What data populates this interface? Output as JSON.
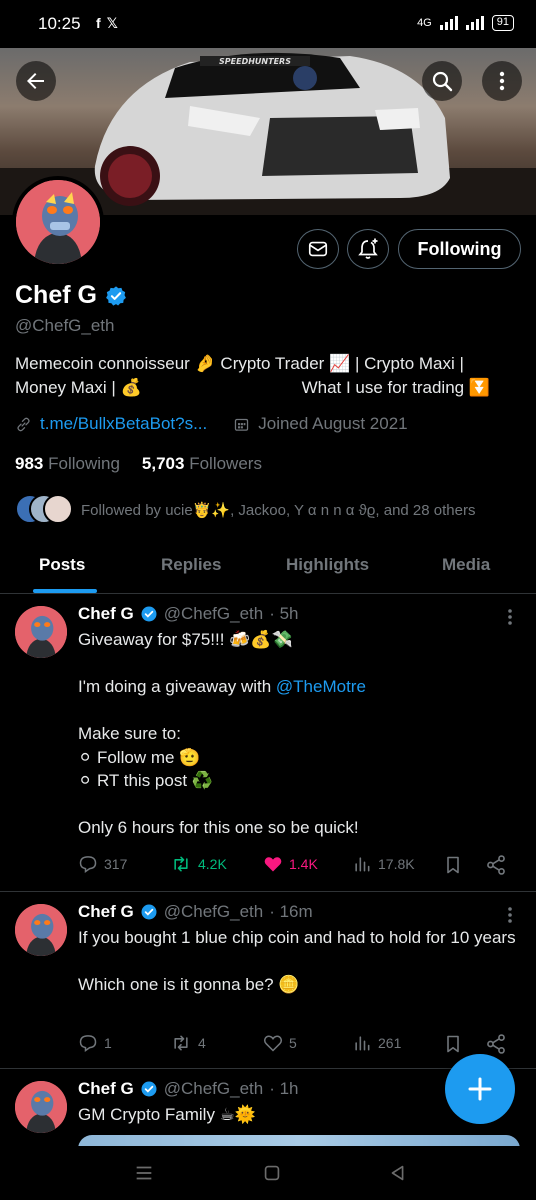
{
  "status_bar": {
    "time": "10:25",
    "left_icons": [
      "facebook-icon",
      "x-icon"
    ],
    "network": "4G",
    "battery": "91"
  },
  "header": {
    "back_icon": "arrow-left-icon",
    "search_icon": "search-icon",
    "more_icon": "more-vertical-icon",
    "banner_text": "SPEEDHUNTERS"
  },
  "profile": {
    "name": "Chef G",
    "verified": true,
    "handle": "@ChefG_eth",
    "bio_line1": "Memecoin connoisseur 🤌 Crypto Trader 📈 | Crypto Maxi |",
    "bio_line2_left": "Money Maxi | 💰",
    "bio_line2_right": "What I use for trading ⏬",
    "link": "t.me/BullxBetaBot?s...",
    "joined": "Joined August 2021",
    "following_count": "983",
    "following_label": "Following",
    "followers_count": "5,703",
    "followers_label": "Followers",
    "followed_by": "Followed by ucie🤴✨, Jackoo, Y α n n α ϑϱ, and 28 others",
    "following_button": "Following"
  },
  "tabs": [
    "Posts",
    "Replies",
    "Highlights",
    "Media"
  ],
  "posts": [
    {
      "name": "Chef G",
      "handle": "@ChefG_eth",
      "time": "· 5h",
      "text_a": "Giveaway for $75!!! 🍻💰💸\n\nI'm doing a giveaway with ",
      "mention": "@TheMotre",
      "text_b": "\n\nMake sure to:\n⚪ Follow me 🫡\n⚪ RT this post ♻️\n\nOnly 6 hours for this one so be quick!",
      "replies": "317",
      "reposts": "4.2K",
      "likes": "1.4K",
      "views": "17.8K"
    },
    {
      "name": "Chef G",
      "handle": "@ChefG_eth",
      "time": "· 16m",
      "text_a": "If you bought 1 blue chip coin and had to hold for 10 years\n\nWhich one is it gonna be? 🪙",
      "replies": "1",
      "reposts": "4",
      "likes": "5",
      "views": "261"
    },
    {
      "name": "Chef G",
      "handle": "@ChefG_eth",
      "time": "· 1h",
      "text_a": "GM Crypto Family ☕🌞"
    }
  ],
  "colors": {
    "accent": "#1d9bf0",
    "repost": "#00ba7c",
    "like": "#f91880",
    "muted": "#71767b",
    "border": "#2f3336",
    "avatar_bg": "#e4626b"
  }
}
